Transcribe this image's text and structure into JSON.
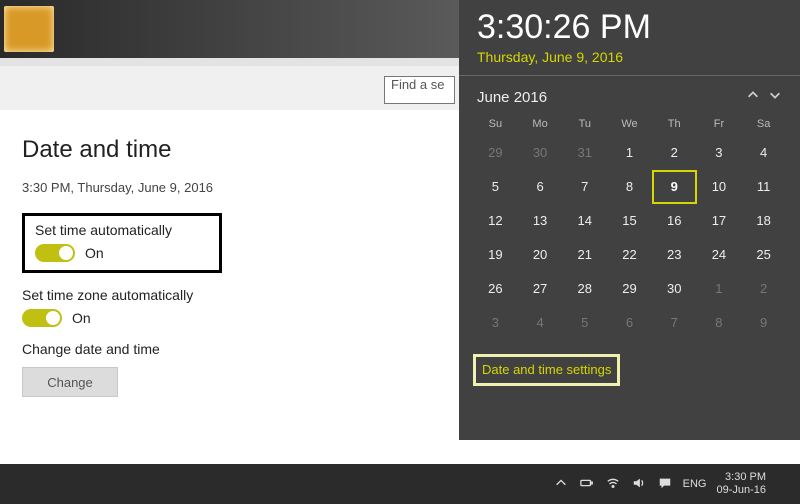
{
  "search": {
    "placeholder": "Find a se"
  },
  "settings": {
    "title": "Date and time",
    "current": "3:30 PM, Thursday, June 9, 2016",
    "auto_time": {
      "label": "Set time automatically",
      "state": "On"
    },
    "auto_tz": {
      "label": "Set time zone automatically",
      "state": "On"
    },
    "change": {
      "label": "Change date and time",
      "button": "Change"
    }
  },
  "flyout": {
    "time": "3:30:26 PM",
    "date": "Thursday, June 9, 2016",
    "month": "June 2016",
    "dow": [
      "Su",
      "Mo",
      "Tu",
      "We",
      "Th",
      "Fr",
      "Sa"
    ],
    "weeks": [
      [
        {
          "n": "29",
          "o": true
        },
        {
          "n": "30",
          "o": true
        },
        {
          "n": "31",
          "o": true
        },
        {
          "n": "1"
        },
        {
          "n": "2"
        },
        {
          "n": "3"
        },
        {
          "n": "4"
        }
      ],
      [
        {
          "n": "5"
        },
        {
          "n": "6"
        },
        {
          "n": "7"
        },
        {
          "n": "8"
        },
        {
          "n": "9",
          "today": true
        },
        {
          "n": "10"
        },
        {
          "n": "11"
        }
      ],
      [
        {
          "n": "12"
        },
        {
          "n": "13"
        },
        {
          "n": "14"
        },
        {
          "n": "15"
        },
        {
          "n": "16"
        },
        {
          "n": "17"
        },
        {
          "n": "18"
        }
      ],
      [
        {
          "n": "19"
        },
        {
          "n": "20"
        },
        {
          "n": "21"
        },
        {
          "n": "22"
        },
        {
          "n": "23"
        },
        {
          "n": "24"
        },
        {
          "n": "25"
        }
      ],
      [
        {
          "n": "26"
        },
        {
          "n": "27"
        },
        {
          "n": "28"
        },
        {
          "n": "29"
        },
        {
          "n": "30"
        },
        {
          "n": "1",
          "o": true
        },
        {
          "n": "2",
          "o": true
        }
      ],
      [
        {
          "n": "3",
          "o": true
        },
        {
          "n": "4",
          "o": true
        },
        {
          "n": "5",
          "o": true
        },
        {
          "n": "6",
          "o": true
        },
        {
          "n": "7",
          "o": true
        },
        {
          "n": "8",
          "o": true
        },
        {
          "n": "9",
          "o": true
        }
      ]
    ],
    "link": "Date and time settings"
  },
  "taskbar": {
    "lang": "ENG",
    "clock_time": "3:30 PM",
    "clock_date": "09-Jun-16"
  }
}
